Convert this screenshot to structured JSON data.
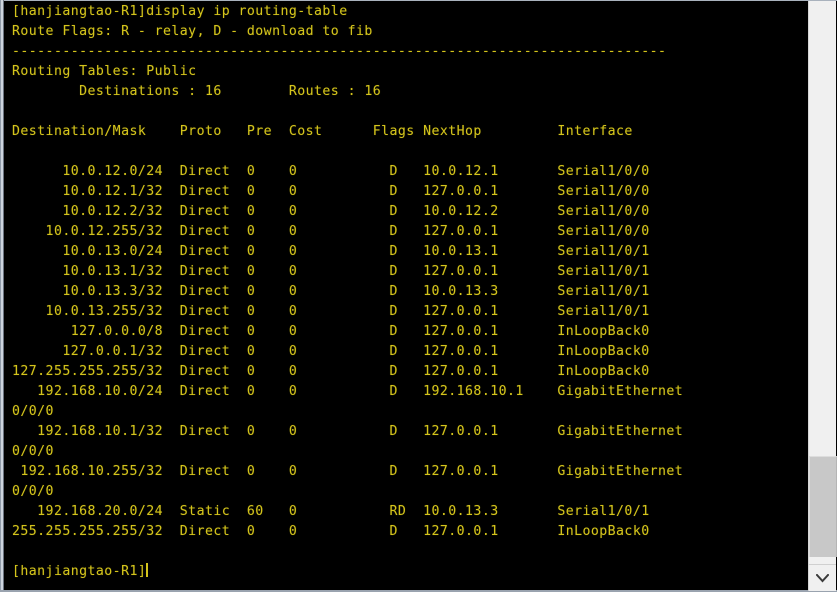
{
  "window": {
    "title": "hanjiangtao-R1 terminal",
    "background_color": "#000000",
    "text_color": "#d4c41c",
    "border_color": "#cdd4dd"
  },
  "terminal": {
    "prompt_name": "[hanjiangtao-R1]",
    "command": "display ip routing-table",
    "command_line": "[hanjiangtao-R1]display ip routing-table",
    "route_flags_line": "Route Flags: R - relay, D - download to fib",
    "separator": "------------------------------------------------------------------------------",
    "routing_tables_label": "Routing Tables: Public",
    "summary_line": "        Destinations : 16        Routes : 16",
    "destinations_count": "16",
    "routes_count": "16",
    "columns": [
      "Destination/Mask",
      "Proto",
      "Pre",
      "Cost",
      "Flags",
      "NextHop",
      "Interface"
    ],
    "header_line": "Destination/Mask    Proto   Pre  Cost         Flags NextHop         Interface",
    "rows": [
      {
        "dest": "10.0.12.0/24",
        "proto": "Direct",
        "pre": "0",
        "cost": "0",
        "flags": "D",
        "nexthop": "10.0.12.1",
        "iface": "Serial1/0/0"
      },
      {
        "dest": "10.0.12.1/32",
        "proto": "Direct",
        "pre": "0",
        "cost": "0",
        "flags": "D",
        "nexthop": "127.0.0.1",
        "iface": "Serial1/0/0"
      },
      {
        "dest": "10.0.12.2/32",
        "proto": "Direct",
        "pre": "0",
        "cost": "0",
        "flags": "D",
        "nexthop": "10.0.12.2",
        "iface": "Serial1/0/0"
      },
      {
        "dest": "10.0.12.255/32",
        "proto": "Direct",
        "pre": "0",
        "cost": "0",
        "flags": "D",
        "nexthop": "127.0.0.1",
        "iface": "Serial1/0/0"
      },
      {
        "dest": "10.0.13.0/24",
        "proto": "Direct",
        "pre": "0",
        "cost": "0",
        "flags": "D",
        "nexthop": "10.0.13.1",
        "iface": "Serial1/0/1"
      },
      {
        "dest": "10.0.13.1/32",
        "proto": "Direct",
        "pre": "0",
        "cost": "0",
        "flags": "D",
        "nexthop": "127.0.0.1",
        "iface": "Serial1/0/1"
      },
      {
        "dest": "10.0.13.3/32",
        "proto": "Direct",
        "pre": "0",
        "cost": "0",
        "flags": "D",
        "nexthop": "10.0.13.3",
        "iface": "Serial1/0/1"
      },
      {
        "dest": "10.0.13.255/32",
        "proto": "Direct",
        "pre": "0",
        "cost": "0",
        "flags": "D",
        "nexthop": "127.0.0.1",
        "iface": "Serial1/0/1"
      },
      {
        "dest": "127.0.0.0/8",
        "proto": "Direct",
        "pre": "0",
        "cost": "0",
        "flags": "D",
        "nexthop": "127.0.0.1",
        "iface": "InLoopBack0"
      },
      {
        "dest": "127.0.0.1/32",
        "proto": "Direct",
        "pre": "0",
        "cost": "0",
        "flags": "D",
        "nexthop": "127.0.0.1",
        "iface": "InLoopBack0"
      },
      {
        "dest": "127.255.255.255/32",
        "proto": "Direct",
        "pre": "0",
        "cost": "0",
        "flags": "D",
        "nexthop": "127.0.0.1",
        "iface": "InLoopBack0"
      },
      {
        "dest": "192.168.10.0/24",
        "proto": "Direct",
        "pre": "0",
        "cost": "0",
        "flags": "D",
        "nexthop": "192.168.10.1",
        "iface": "GigabitEthernet0/0/0"
      },
      {
        "dest": "192.168.10.1/32",
        "proto": "Direct",
        "pre": "0",
        "cost": "0",
        "flags": "D",
        "nexthop": "127.0.0.1",
        "iface": "GigabitEthernet0/0/0"
      },
      {
        "dest": "192.168.10.255/32",
        "proto": "Direct",
        "pre": "0",
        "cost": "0",
        "flags": "D",
        "nexthop": "127.0.0.1",
        "iface": "GigabitEthernet0/0/0"
      },
      {
        "dest": "192.168.20.0/24",
        "proto": "Static",
        "pre": "60",
        "cost": "0",
        "flags": "RD",
        "nexthop": "10.0.13.3",
        "iface": "Serial1/0/1"
      },
      {
        "dest": "255.255.255.255/32",
        "proto": "Direct",
        "pre": "0",
        "cost": "0",
        "flags": "D",
        "nexthop": "127.0.0.1",
        "iface": "InLoopBack0"
      }
    ],
    "final_prompt": "[hanjiangtao-R1]",
    "screen_text": "[hanjiangtao-R1]display ip routing-table\nRoute Flags: R - relay, D - download to fib\n------------------------------------------------------------------------------\nRouting Tables: Public\n        Destinations : 16        Routes : 16\n\nDestination/Mask    Proto   Pre  Cost      Flags NextHop         Interface\n\n      10.0.12.0/24  Direct  0    0           D   10.0.12.1       Serial1/0/0\n      10.0.12.1/32  Direct  0    0           D   127.0.0.1       Serial1/0/0\n      10.0.12.2/32  Direct  0    0           D   10.0.12.2       Serial1/0/0\n    10.0.12.255/32  Direct  0    0           D   127.0.0.1       Serial1/0/0\n      10.0.13.0/24  Direct  0    0           D   10.0.13.1       Serial1/0/1\n      10.0.13.1/32  Direct  0    0           D   127.0.0.1       Serial1/0/1\n      10.0.13.3/32  Direct  0    0           D   10.0.13.3       Serial1/0/1\n    10.0.13.255/32  Direct  0    0           D   127.0.0.1       Serial1/0/1\n       127.0.0.0/8  Direct  0    0           D   127.0.0.1       InLoopBack0\n      127.0.0.1/32  Direct  0    0           D   127.0.0.1       InLoopBack0\n127.255.255.255/32  Direct  0    0           D   127.0.0.1       InLoopBack0\n   192.168.10.0/24  Direct  0    0           D   192.168.10.1    GigabitEthernet\n0/0/0\n   192.168.10.1/32  Direct  0    0           D   127.0.0.1       GigabitEthernet\n0/0/0\n 192.168.10.255/32  Direct  0    0           D   127.0.0.1       GigabitEthernet\n0/0/0\n   192.168.20.0/24  Static  60   0           RD  10.0.13.3       Serial1/0/1\n255.255.255.255/32  Direct  0    0           D   127.0.0.1       InLoopBack0\n\n"
  },
  "scrollbar": {
    "down_arrow_icon": "chevron-down-icon",
    "track_color": "#f0f0f0",
    "thumb_color": "#c8c8c8"
  }
}
